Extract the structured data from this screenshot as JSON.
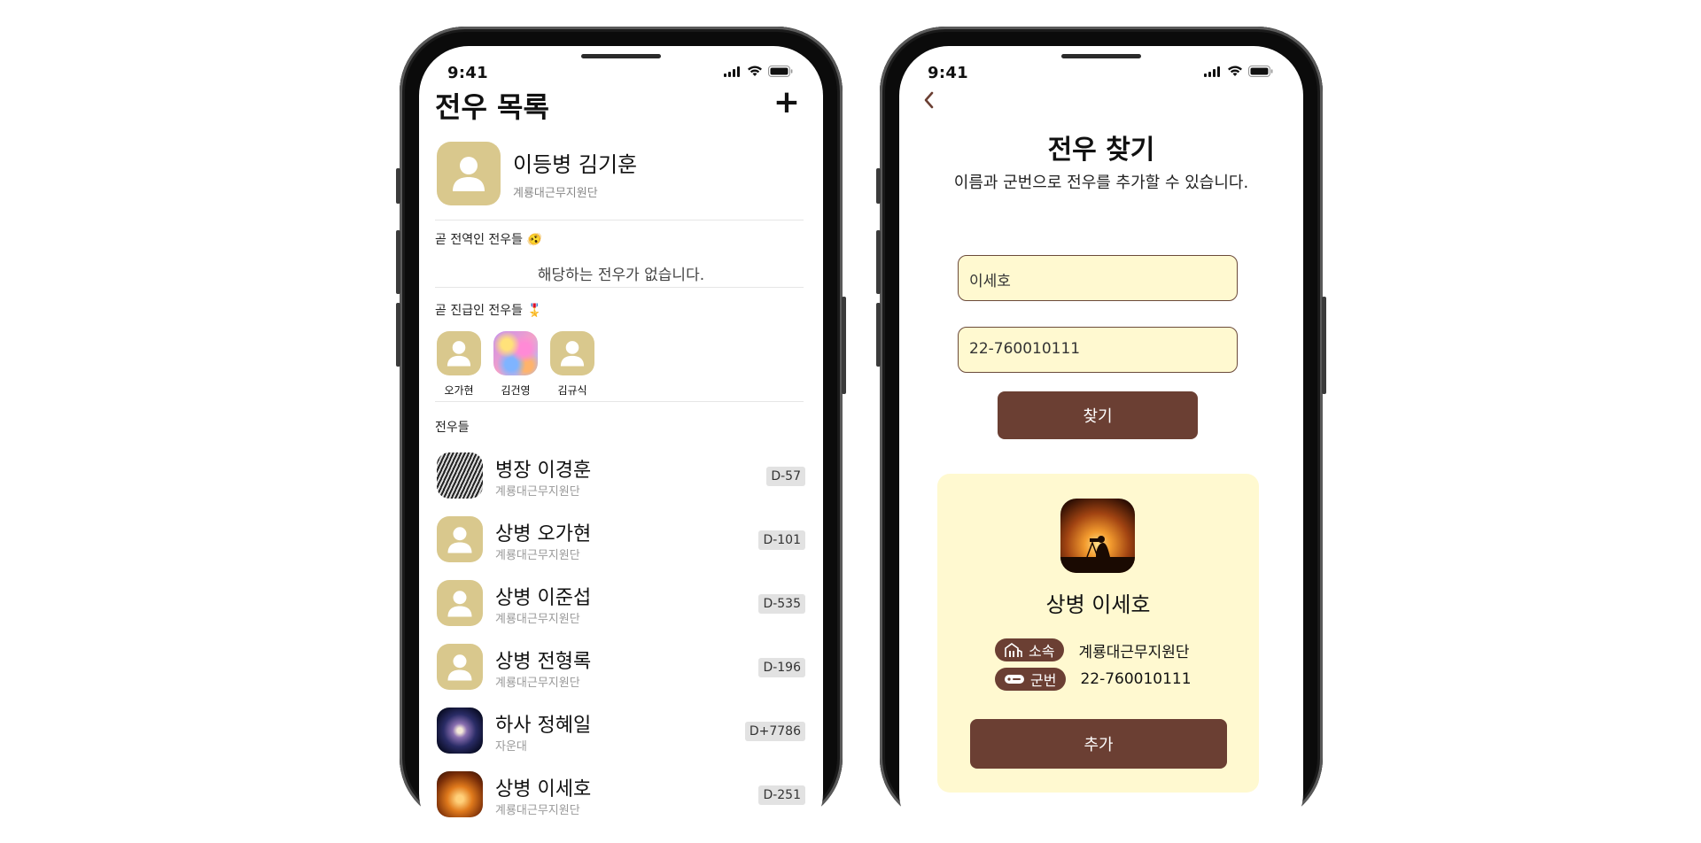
{
  "status_bar": {
    "time": "9:41"
  },
  "list_screen": {
    "title": "전우 목록",
    "add_icon": "plus-icon",
    "me": {
      "name": "이등병 김기훈",
      "unit": "계룡대근무지원단"
    },
    "discharge_section": {
      "title": "곧 전역인 전우들 🫨",
      "empty_text": "해당하는 전우가 없습니다."
    },
    "promotion_section": {
      "title": "곧 진급인 전우들 🎖️",
      "people": [
        {
          "name": "오가현",
          "avatar": "default"
        },
        {
          "name": "김건영",
          "avatar": "colorful-photo"
        },
        {
          "name": "김규식",
          "avatar": "default"
        }
      ]
    },
    "friends_section": {
      "title": "전우들",
      "items": [
        {
          "name": "병장 이경훈",
          "unit": "계룡대근무지원단",
          "dday": "D-57",
          "avatar": "pattern-photo"
        },
        {
          "name": "상병 오가현",
          "unit": "계룡대근무지원단",
          "dday": "D-101",
          "avatar": "default"
        },
        {
          "name": "상병 이준섭",
          "unit": "계룡대근무지원단",
          "dday": "D-535",
          "avatar": "default"
        },
        {
          "name": "상병 전형록",
          "unit": "계룡대근무지원단",
          "dday": "D-196",
          "avatar": "default"
        },
        {
          "name": "하사 정혜일",
          "unit": "자운대",
          "dday": "D+7786",
          "avatar": "galaxy-photo"
        },
        {
          "name": "상병 이세호",
          "unit": "계룡대근무지원단",
          "dday": "D-251",
          "avatar": "sunset-photo"
        }
      ]
    }
  },
  "search_screen": {
    "back_icon": "chevron-left-icon",
    "title": "전우 찾기",
    "subtitle": "이름과 군번으로 전우를 추가할 수 있습니다.",
    "name_value": "이세호",
    "service_number_value": "22-760010111",
    "find_label": "찾기",
    "result": {
      "name": "상병 이세호",
      "unit_tag": "소속",
      "unit_value": "계룡대근무지원단",
      "number_tag": "군번",
      "number_value": "22-760010111",
      "add_label": "추가"
    }
  },
  "colors": {
    "accent": "#6b3f33",
    "field_bg": "#fff9d0",
    "avatar_bg": "#d9c88d"
  }
}
